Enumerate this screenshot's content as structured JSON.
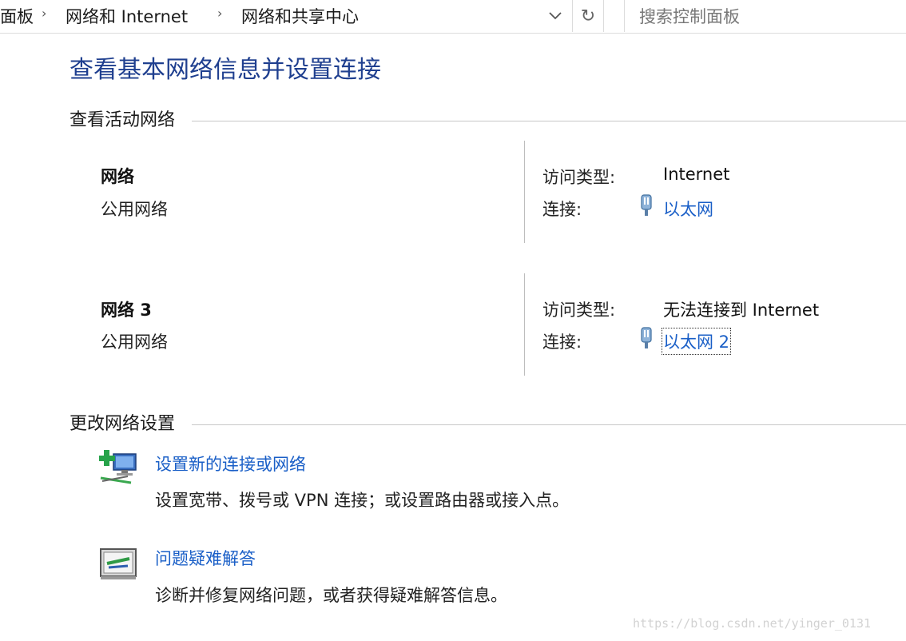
{
  "address_bar": {
    "breadcrumbs": [
      "面板",
      "网络和 Internet",
      "网络和共享中心"
    ],
    "separator": "›",
    "search_placeholder": "搜索控制面板",
    "refresh_glyph": "↻"
  },
  "page": {
    "title": "查看基本网络信息并设置连接"
  },
  "active_networks": {
    "heading": "查看活动网络",
    "access_label": "访问类型:",
    "connection_label": "连接:",
    "networks": [
      {
        "name": "网络",
        "type": "公用网络",
        "access": "Internet",
        "connection": "以太网",
        "icon": "ethernet-icon"
      },
      {
        "name": "网络 3",
        "type": "公用网络",
        "access": "无法连接到 Internet",
        "connection": "以太网 2",
        "icon": "ethernet-icon"
      }
    ]
  },
  "change_settings": {
    "heading": "更改网络设置",
    "tasks": [
      {
        "title": "设置新的连接或网络",
        "desc": "设置宽带、拨号或 VPN 连接；或设置路由器或接入点。",
        "icon": "new-connection-icon"
      },
      {
        "title": "问题疑难解答",
        "desc": "诊断并修复网络问题，或者获得疑难解答信息。",
        "icon": "troubleshoot-icon"
      }
    ]
  },
  "watermark": "https://blog.csdn.net/yinger_0131",
  "colors": {
    "link": "#1a5fc7",
    "title": "#1f3f8f"
  }
}
